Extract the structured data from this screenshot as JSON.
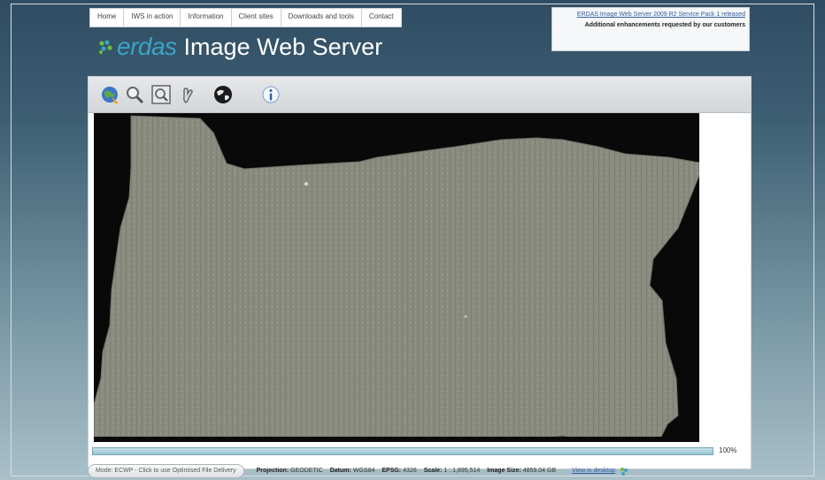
{
  "nav": {
    "items": [
      "Home",
      "IWS in action",
      "Information",
      "Client sites",
      "Downloads and tools",
      "Contact"
    ]
  },
  "notice": {
    "link_text": "ERDAS Image Web Server 2009 R2 Service Pack 1 released",
    "text": "Additional enhancements requested by our customers"
  },
  "logo": {
    "brand": "erdas",
    "product": "Image Web Server"
  },
  "toolbar": {
    "tools": [
      "globe-navigate-icon",
      "zoom-icon",
      "zoom-box-icon",
      "pan-hand-icon",
      "world-icon",
      "info-icon"
    ]
  },
  "map": {
    "background": "#090909",
    "imagery_color": "#8a8c7f"
  },
  "progress": {
    "value": 1.0,
    "label": "100%"
  },
  "status": {
    "mode_button": "Mode: ECWP - Click to use Optimised File Delivery",
    "projection_label": "Projection:",
    "projection_value": "GEODETIC",
    "datum_label": "Datum:",
    "datum_value": "WGS84",
    "epsg_label": "EPSG:",
    "epsg_value": "4326",
    "scale_label": "Scale:",
    "scale_value": "1 : 1,895,514",
    "size_label": "Image Size:",
    "size_value": "4859.04 GB",
    "view_link": "View in desktop"
  }
}
